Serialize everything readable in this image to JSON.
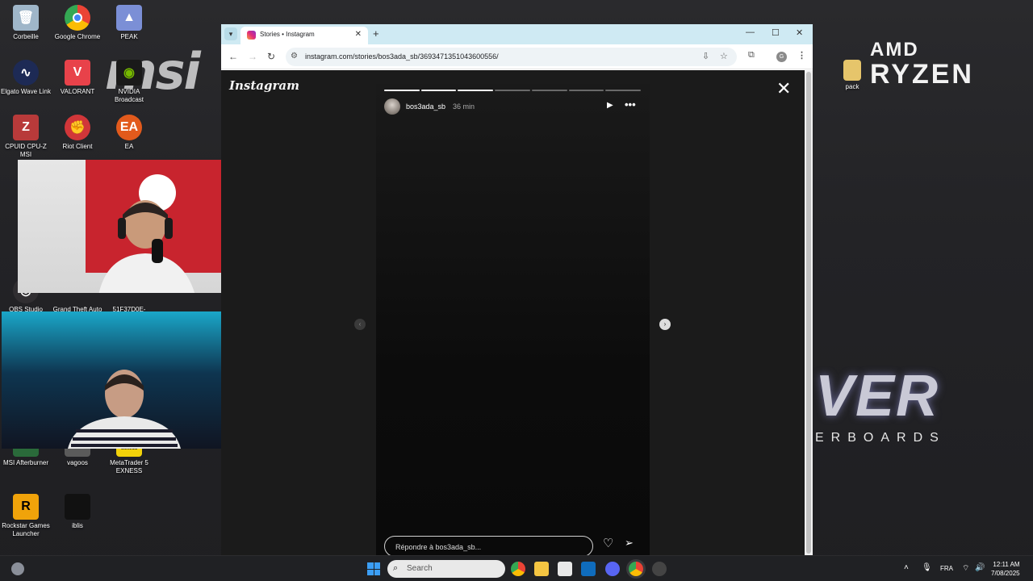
{
  "desktop": {
    "icons": [
      {
        "label": "Corbeille",
        "icon": "recycle-bin-icon",
        "color": "#9fb6c9"
      },
      {
        "label": "Google Chrome",
        "icon": "chrome-icon",
        "color": "#4285f4"
      },
      {
        "label": "PEAK",
        "icon": "peak-icon",
        "color": "#7b8fd6"
      },
      {
        "label": "Elgato Wave Link",
        "icon": "wave-link-icon",
        "color": "#1d2a55"
      },
      {
        "label": "VALORANT",
        "icon": "valorant-icon",
        "color": "#e8424a"
      },
      {
        "label": "NVIDIA Broadcast",
        "icon": "nvidia-broadcast-icon",
        "color": "#76b900"
      },
      {
        "label": "CPUID CPU-Z MSI",
        "icon": "cpuz-icon",
        "color": "#b83a3a"
      },
      {
        "label": "Riot Client",
        "icon": "riot-client-icon",
        "color": "#d13639"
      },
      {
        "label": "EA",
        "icon": "ea-icon",
        "color": "#e25a1c"
      },
      {
        "label": "OBS Studio",
        "icon": "obs-icon",
        "color": "#302e31"
      },
      {
        "label": "Grand Theft Auto ...",
        "icon": "gta-icon",
        "color": "#4b4b4b"
      },
      {
        "label": "51F37D0E-5002...",
        "icon": "file-icon",
        "color": "#3a3a3a"
      },
      {
        "label": "MSI Afterburner",
        "icon": "afterburner-icon",
        "color": "#a01f24"
      },
      {
        "label": "vagoos",
        "icon": "vagoos-icon",
        "color": "#5b5b5b"
      },
      {
        "label": "MetaTrader 5 EXNESS",
        "icon": "metatrader-icon",
        "color": "#f2d20a"
      },
      {
        "label": "Rockstar Games Launcher",
        "icon": "rockstar-icon",
        "color": "#f0a30a"
      },
      {
        "label": "iblis",
        "icon": "iblis-icon",
        "color": "#111111"
      },
      {
        "label": "pack",
        "icon": "folder-icon",
        "color": "#e6c56b"
      }
    ],
    "wallpaper": {
      "msi": "msi",
      "amd": "AMD",
      "ryzen": "RYZEN",
      "ver": "VER",
      "erboards": "ERBOARDS"
    }
  },
  "browser": {
    "tab_title": "Stories • Instagram",
    "url": "instagram.com/stories/bos3ada_sb/3693471351043600556/",
    "profile_initial": "G"
  },
  "story": {
    "brand": "Instagram",
    "username": "bos3ada_sb",
    "time": "36 min",
    "segments_total": 7,
    "segments_done": 3,
    "reply_placeholder": "Répondre à bos3ada_sb..."
  },
  "taskbar": {
    "search_placeholder": "Search",
    "language": "FRA",
    "time": "12:11 AM",
    "date": "7/08/2025"
  }
}
